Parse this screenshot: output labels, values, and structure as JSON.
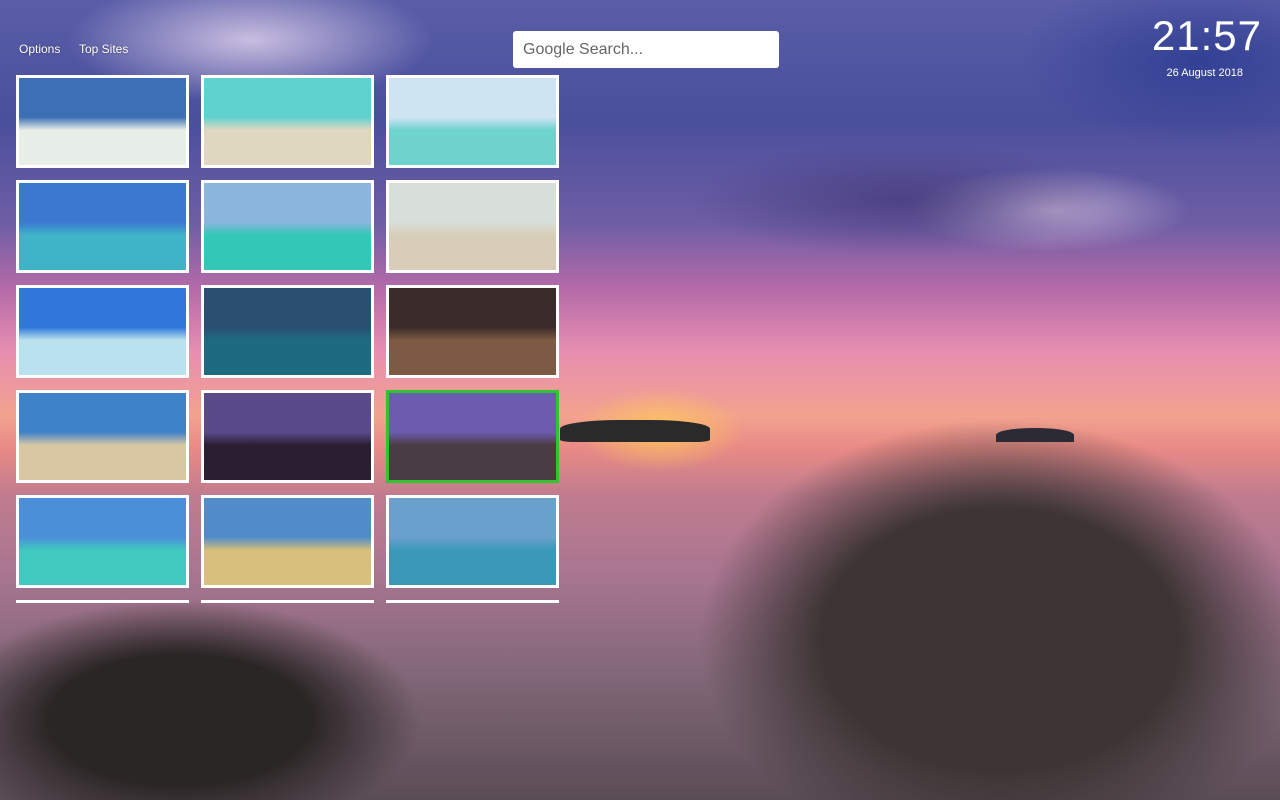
{
  "nav": {
    "options": "Options",
    "top_sites": "Top Sites"
  },
  "search": {
    "placeholder": "Google Search..."
  },
  "clock": {
    "time": "21:57",
    "date": "26 August 2018"
  },
  "accent_selected": "#2ec52e",
  "thumbnails": [
    {
      "sky": "#3d6fb5",
      "water": "#e8eee8",
      "selected": false
    },
    {
      "sky": "#5fd2cf",
      "water": "#e0d7c0",
      "selected": false
    },
    {
      "sky": "#cfe4f3",
      "water": "#6fd3cd",
      "selected": false
    },
    {
      "sky": "#3b78d0",
      "water": "#3fb3c8",
      "selected": false
    },
    {
      "sky": "#8cb6de",
      "water": "#33c7b5",
      "selected": false
    },
    {
      "sky": "#d8ded8",
      "water": "#d8cdb8",
      "selected": false
    },
    {
      "sky": "#2f77d8",
      "water": "#b9e2ee",
      "selected": false
    },
    {
      "sky": "#2a4f70",
      "water": "#1c6b80",
      "selected": false
    },
    {
      "sky": "#3a2c2a",
      "water": "#7c5a44",
      "selected": false
    },
    {
      "sky": "#3e82c8",
      "water": "#d9c7a4",
      "selected": false
    },
    {
      "sky": "#5a4a8c",
      "water": "#2a1f30",
      "selected": false
    },
    {
      "sky": "#6c5cb0",
      "water": "#4a3c44",
      "selected": true
    },
    {
      "sky": "#4b8fd8",
      "water": "#3fc9bf",
      "selected": false
    },
    {
      "sky": "#4f8cc8",
      "water": "#d8c07c",
      "selected": false
    },
    {
      "sky": "#6aa0cc",
      "water": "#3a98b8",
      "selected": false
    },
    {
      "sky": "#cccccc",
      "water": "#999999",
      "selected": false
    },
    {
      "sky": "#cccccc",
      "water": "#999999",
      "selected": false
    },
    {
      "sky": "#cccccc",
      "water": "#999999",
      "selected": false
    }
  ]
}
